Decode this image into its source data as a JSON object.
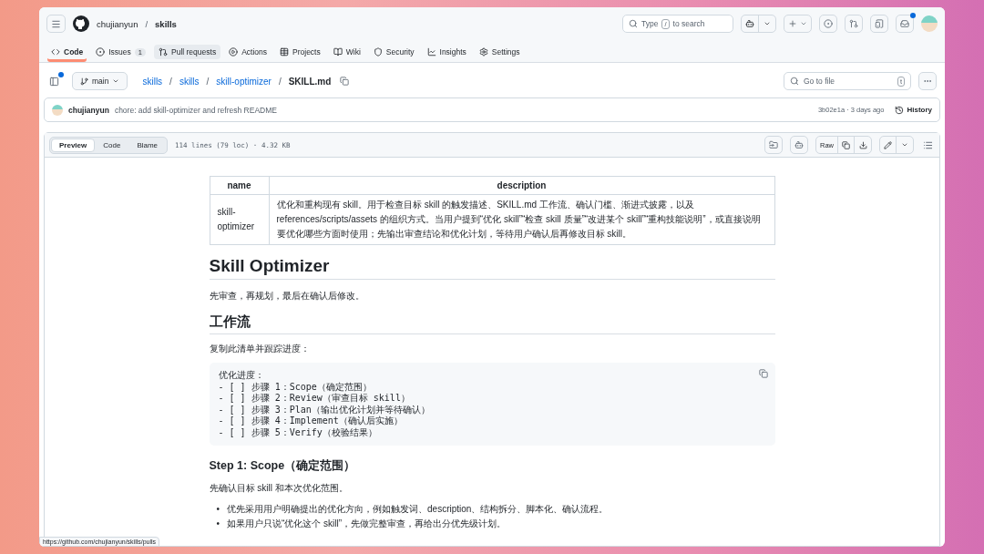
{
  "header": {
    "owner": "chujianyun",
    "separator": "/",
    "repo": "skills",
    "search": {
      "before": "Type",
      "key": "/",
      "after": "to search"
    },
    "inbox_unread": true
  },
  "nav": [
    {
      "label": "Code",
      "selected": true,
      "hovered": false
    },
    {
      "label": "Issues",
      "count": "1",
      "selected": false,
      "hovered": false
    },
    {
      "label": "Pull requests",
      "selected": false,
      "hovered": true
    },
    {
      "label": "Actions",
      "selected": false,
      "hovered": false
    },
    {
      "label": "Projects",
      "selected": false,
      "hovered": false
    },
    {
      "label": "Wiki",
      "selected": false,
      "hovered": false
    },
    {
      "label": "Security",
      "selected": false,
      "hovered": false
    },
    {
      "label": "Insights",
      "selected": false,
      "hovered": false
    },
    {
      "label": "Settings",
      "selected": false,
      "hovered": false
    }
  ],
  "path": {
    "sidebar_dot": true,
    "branch": "main",
    "separator": "/",
    "crumbs": [
      {
        "label": "skills",
        "link": true
      },
      {
        "label": "skills",
        "link": true
      },
      {
        "label": "skill-optimizer",
        "link": true
      },
      {
        "label": "SKILL.md",
        "link": false
      }
    ],
    "go_to_file": {
      "placeholder": "Go to file",
      "key": "t"
    }
  },
  "commit": {
    "author": "chujianyun",
    "message": "chore: add skill-optimizer and refresh README",
    "sha_time": "3b02e1a · 3 days ago",
    "history": "History"
  },
  "file": {
    "views": [
      {
        "label": "Preview",
        "selected": true
      },
      {
        "label": "Code",
        "selected": false
      },
      {
        "label": "Blame",
        "selected": false
      }
    ],
    "info": "114 lines (79 loc) · 4.32 KB",
    "raw": "Raw"
  },
  "doc": {
    "table": {
      "columns": [
        "name",
        "description"
      ],
      "rows": [
        [
          "skill-optimizer",
          "优化和重构现有 skill。用于检查目标 skill 的触发描述、SKILL.md 工作流、确认门槛、渐进式披露，以及 references/scripts/assets 的组织方式。当用户提到“优化 skill”“检查 skill 质量”“改进某个 skill”“重构技能说明”，或直接说明要优化哪些方面时使用；先输出审查结论和优化计划，等待用户确认后再修改目标 skill。"
        ]
      ]
    },
    "blocks": [
      {
        "kind": "h1",
        "text": "Skill Optimizer"
      },
      {
        "kind": "p",
        "text": "先审查，再规划，最后在确认后修改。"
      },
      {
        "kind": "h2",
        "text": "工作流"
      },
      {
        "kind": "p",
        "text": "复制此清单并跟踪进度："
      },
      {
        "kind": "code",
        "lines": [
          "优化进度：",
          "- [ ] 步骤 1：Scope（确定范围）",
          "- [ ] 步骤 2：Review（审查目标 skill）",
          "- [ ] 步骤 3：Plan（输出优化计划并等待确认）",
          "- [ ] 步骤 4：Implement（确认后实施）",
          "- [ ] 步骤 5：Verify（校验结果）"
        ]
      },
      {
        "kind": "h3",
        "text": "Step 1: Scope（确定范围）"
      },
      {
        "kind": "p",
        "text": "先确认目标 skill 和本次优化范围。"
      },
      {
        "kind": "ul",
        "marker": "•",
        "items": [
          "优先采用用户明确提出的优化方向，例如触发词、description、结构拆分、脚本化、确认流程。",
          "如果用户只说“优化这个 skill”，先做完整审查，再给出分优先级计划。"
        ]
      }
    ]
  },
  "status_url": "https://github.com/chujianyun/skills/pulls"
}
